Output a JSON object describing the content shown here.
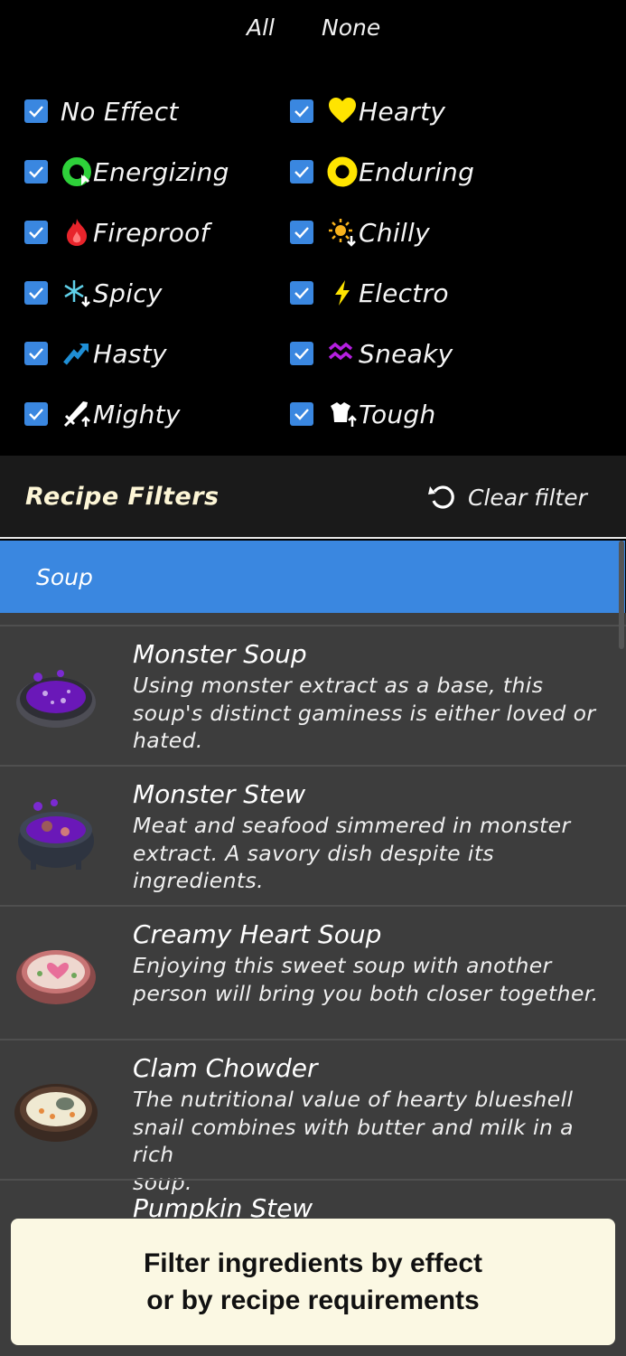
{
  "quick_select": {
    "all": "All",
    "none": "None"
  },
  "effects": [
    {
      "label": "No Effect",
      "icon": "none",
      "checked": true
    },
    {
      "label": "Hearty",
      "icon": "heart-icon",
      "color": "#ffe400",
      "checked": true
    },
    {
      "label": "Energizing",
      "icon": "energizing-icon",
      "color": "#2ed13a",
      "checked": true
    },
    {
      "label": "Enduring",
      "icon": "enduring-icon",
      "color": "#ffe400",
      "checked": true
    },
    {
      "label": "Fireproof",
      "icon": "flame-icon",
      "color": "#e8242b",
      "checked": true
    },
    {
      "label": "Chilly",
      "icon": "sun-down-icon",
      "color": "#f7b21c",
      "checked": true
    },
    {
      "label": "Spicy",
      "icon": "snowflake-up-icon",
      "color": "#5fd0e8",
      "checked": true
    },
    {
      "label": "Electro",
      "icon": "lightning-icon",
      "color": "#ffe400",
      "checked": true
    },
    {
      "label": "Hasty",
      "icon": "hasty-arrow-icon",
      "color": "#1f8fd6",
      "checked": true
    },
    {
      "label": "Sneaky",
      "icon": "sneaky-wave-icon",
      "color": "#b51fe0",
      "checked": true
    },
    {
      "label": "Mighty",
      "icon": "sword-up-icon",
      "color": "#ffffff",
      "checked": true
    },
    {
      "label": "Tough",
      "icon": "armor-up-icon",
      "color": "#ffffff",
      "checked": true
    }
  ],
  "recipe_filters": {
    "title": "Recipe Filters",
    "clear": "Clear filter"
  },
  "selected_category": "Soup",
  "recipes": [
    {
      "name": "Monster Soup",
      "desc_lines": [
        "Using monster extract as a base, this",
        "soup's distinct gaminess is either loved or",
        "hated."
      ]
    },
    {
      "name": "Monster Stew",
      "desc_lines": [
        "Meat and seafood simmered in monster",
        "extract. A savory dish despite its",
        "ingredients."
      ]
    },
    {
      "name": "Creamy Heart Soup",
      "desc_lines": [
        "Enjoying this sweet soup with another",
        "person will bring you both closer together."
      ]
    },
    {
      "name": "Clam Chowder",
      "desc_lines": [
        "The nutritional value of hearty blueshell",
        "snail combines with butter and milk in a rich",
        "soup."
      ]
    },
    {
      "name": "Pumpkin Stew",
      "desc_lines": []
    }
  ],
  "banner": {
    "line1": "Filter ingredients by effect",
    "line2": "or by recipe requirements"
  },
  "colors": {
    "accent": "#3a87e0",
    "list_bg": "#3d3d3d",
    "banner_bg": "#fbf8e3",
    "header_text": "#fdf6d6"
  }
}
